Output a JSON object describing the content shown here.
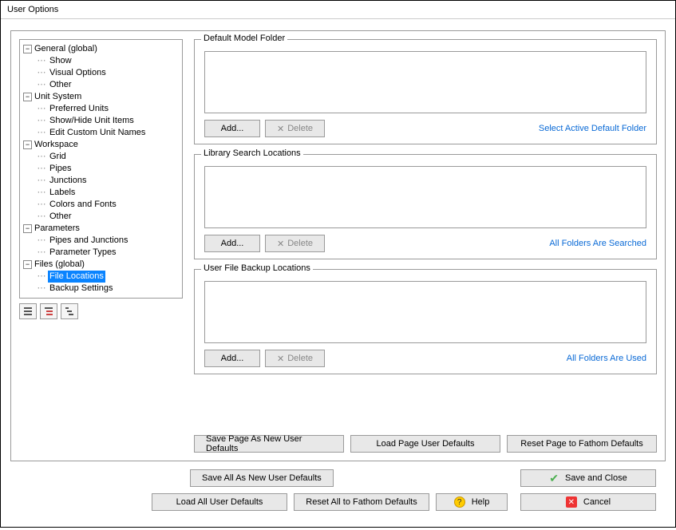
{
  "title": "User Options",
  "tree": {
    "general": {
      "label": "General (global)",
      "children": {
        "show": "Show",
        "visual": "Visual Options",
        "other": "Other"
      }
    },
    "unitsystem": {
      "label": "Unit System",
      "children": {
        "preferred": "Preferred Units",
        "showhide": "Show/Hide Unit Items",
        "editcustom": "Edit Custom Unit Names"
      }
    },
    "workspace": {
      "label": "Workspace",
      "children": {
        "grid": "Grid",
        "pipes": "Pipes",
        "junctions": "Junctions",
        "labels": "Labels",
        "colorsfonts": "Colors and Fonts",
        "other": "Other"
      }
    },
    "parameters": {
      "label": "Parameters",
      "children": {
        "pipesjunctions": "Pipes and Junctions",
        "paramtypes": "Parameter Types"
      }
    },
    "files": {
      "label": "Files (global)",
      "children": {
        "filelocations": "File Locations",
        "backup": "Backup Settings"
      }
    }
  },
  "groups": {
    "defaultmodel": {
      "title": "Default Model Folder",
      "add": "Add...",
      "delete": "Delete",
      "link": "Select Active Default Folder"
    },
    "library": {
      "title": "Library Search Locations",
      "add": "Add...",
      "delete": "Delete",
      "link": "All Folders Are Searched"
    },
    "backup": {
      "title": "User File Backup Locations",
      "add": "Add...",
      "delete": "Delete",
      "link": "All Folders Are Used"
    }
  },
  "page_buttons": {
    "save_page": "Save Page As New User Defaults",
    "load_page": "Load Page User Defaults",
    "reset_page": "Reset Page to Fathom Defaults"
  },
  "footer": {
    "save_all": "Save All As New User Defaults",
    "load_all": "Load All User Defaults",
    "reset_all": "Reset All to Fathom Defaults",
    "help": "Help",
    "save_close": "Save and Close",
    "cancel": "Cancel"
  }
}
